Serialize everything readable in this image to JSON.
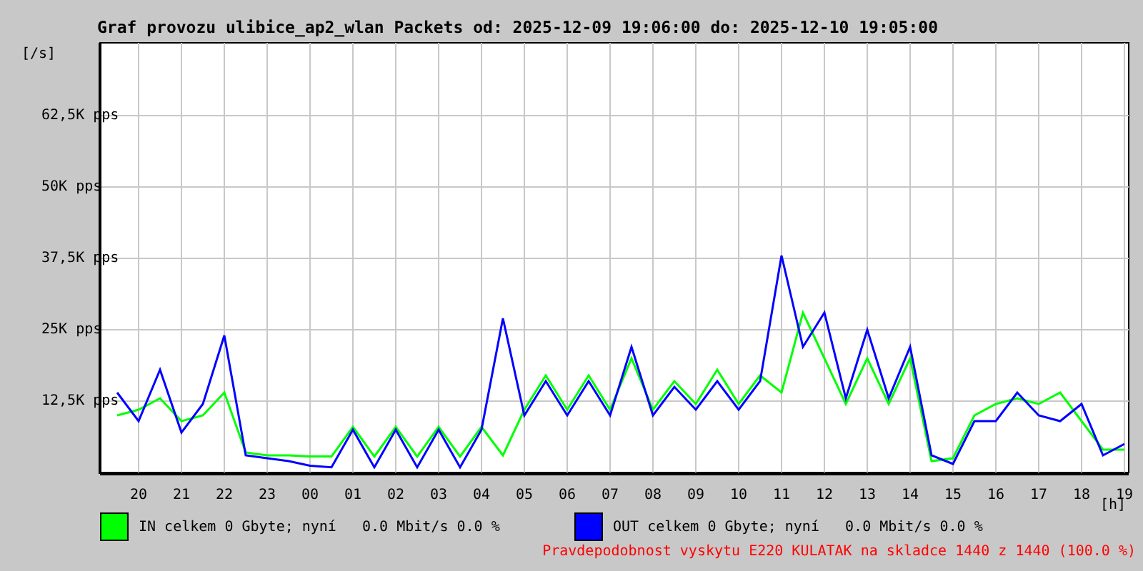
{
  "title": "Graf provozu ulibice_ap2_wlan Packets od: 2025-12-09 19:06:00 do: 2025-12-10 19:05:00",
  "chart_data": {
    "type": "line",
    "ylabel": "[/s]",
    "xlabel": "[h]",
    "categories": [
      null,
      "20",
      null,
      "21",
      null,
      "22",
      null,
      "23",
      null,
      "00",
      null,
      "01",
      null,
      "02",
      null,
      "03",
      null,
      "04",
      null,
      "05",
      null,
      "06",
      null,
      "07",
      null,
      "08",
      null,
      "09",
      null,
      "10",
      null,
      "11",
      null,
      "12",
      null,
      "13",
      null,
      "14",
      null,
      "15",
      null,
      "16",
      null,
      "17",
      null,
      "18",
      null,
      "19"
    ],
    "series": [
      {
        "name": "IN",
        "color": "#00ff00",
        "values": [
          10000,
          11000,
          13000,
          9000,
          10000,
          14000,
          3500,
          3000,
          3000,
          2800,
          2800,
          8000,
          2800,
          8000,
          2800,
          8000,
          2800,
          8000,
          3000,
          11000,
          17000,
          11000,
          17000,
          11000,
          20000,
          11000,
          16000,
          12000,
          18000,
          12000,
          17000,
          14000,
          28000,
          20000,
          12000,
          20000,
          12000,
          20000,
          2000,
          2500,
          10000,
          12000,
          13000,
          12000,
          14000,
          9000,
          4000,
          4000
        ]
      },
      {
        "name": "OUT",
        "color": "#0000ff",
        "values": [
          14000,
          9000,
          18000,
          7000,
          12000,
          24000,
          3000,
          2500,
          2000,
          1200,
          900,
          7500,
          900,
          7500,
          900,
          7500,
          900,
          7500,
          27000,
          10000,
          16000,
          10000,
          16000,
          10000,
          22000,
          10000,
          15000,
          11000,
          16000,
          11000,
          16000,
          38000,
          22000,
          28000,
          13000,
          25000,
          13000,
          22000,
          3000,
          1500,
          9000,
          9000,
          14000,
          10000,
          9000,
          12000,
          3000,
          5000
        ]
      }
    ],
    "ylim": [
      0,
      75000
    ],
    "grid": true,
    "yticks": [
      {
        "value": 12500,
        "label": "12,5K pps"
      },
      {
        "value": 25000,
        "label": "25K pps"
      },
      {
        "value": 37500,
        "label": "37,5K pps"
      },
      {
        "value": 50000,
        "label": "50K pps"
      },
      {
        "value": 62500,
        "label": "62,5K pps"
      }
    ]
  },
  "legend": [
    {
      "text": "celkem 0 Gbyte; nyní   0.0 Mbit/s 0.0 %"
    },
    {
      "text": "celkem 0 Gbyte; nyní   0.0 Mbit/s 0.0 %"
    }
  ],
  "footer_note": "Pravdepodobnost vyskytu E220 KULATAK na skladce 1440 z 1440 (100.0 %)"
}
